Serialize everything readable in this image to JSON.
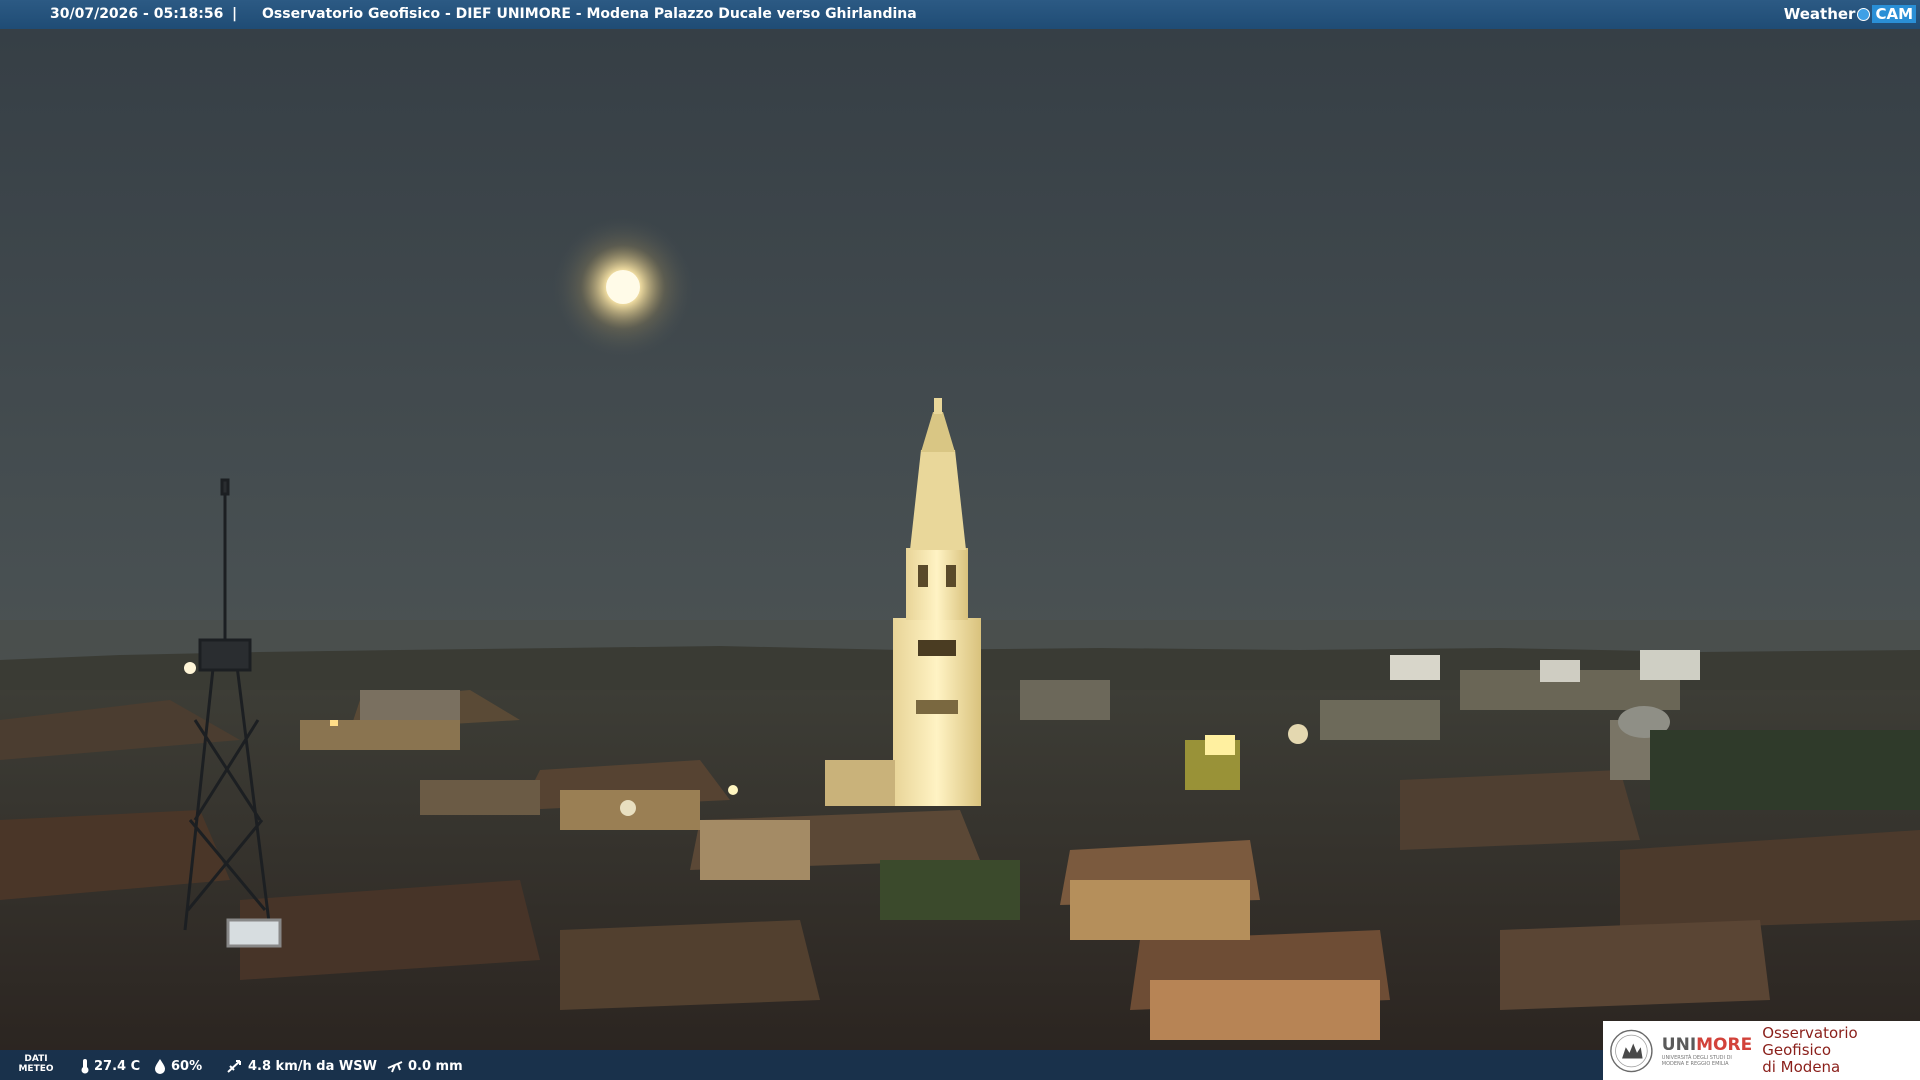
{
  "header": {
    "datetime": "30/07/2026 - 05:18:56",
    "separator": "|",
    "title": "Osservatorio Geofisico - DIEF UNIMORE - Modena Palazzo Ducale verso Ghirlandina",
    "brand_weather": "Weather",
    "brand_cam": "CAM"
  },
  "weather": {
    "label_line1": "DATI",
    "label_line2": "METEO",
    "temperature": "27.4 C",
    "humidity": "60%",
    "wind": "4.8 km/h da WSW",
    "rain": "0.0 mm",
    "icons": [
      "thermometer-icon",
      "humidity-drop-icon",
      "wind-icon",
      "rain-gauge-icon"
    ]
  },
  "logo": {
    "uni_part1": "UNI",
    "uni_part2": "MORE",
    "uni_small1": "UNIVERSITÀ DEGLI STUDI DI",
    "uni_small2": "MODENA E REGGIO EMILIA",
    "observatory_line1": "Osservatorio Geofisico",
    "observatory_line2": "di Modena"
  },
  "colors": {
    "bar": "#1f4c75",
    "accent_red": "#d2423a",
    "observatory_text": "#8a1f1a"
  }
}
